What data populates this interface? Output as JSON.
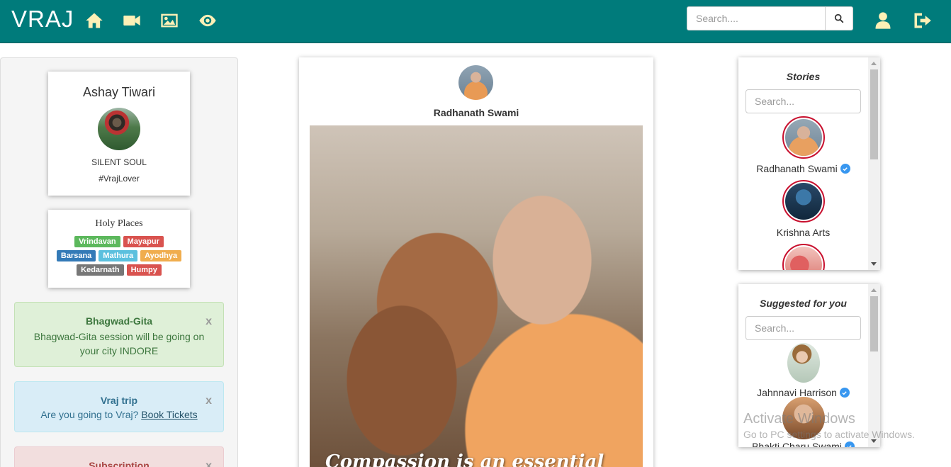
{
  "navbar": {
    "brand": "VRAJ",
    "search_placeholder": "Search....",
    "icons": [
      "home-icon",
      "video-camera-icon",
      "image-icon",
      "eye-icon",
      "user-icon",
      "logout-icon",
      "search-icon"
    ],
    "color": "#007b7b",
    "icon_color": "#fdf0b6"
  },
  "profile": {
    "name": "Ashay Tiwari",
    "status": "SILENT SOUL",
    "tag": "#VrajLover"
  },
  "holy_places": {
    "title": "Holy Places",
    "items": [
      {
        "label": "Vrindavan",
        "color": "#5cb85c"
      },
      {
        "label": "Mayapur",
        "color": "#d9534f"
      },
      {
        "label": "Barsana",
        "color": "#337ab7"
      },
      {
        "label": "Mathura",
        "color": "#5bc0de"
      },
      {
        "label": "Ayodhya",
        "color": "#f0ad4e"
      },
      {
        "label": "Kedarnath",
        "color": "#777777"
      },
      {
        "label": "Humpy",
        "color": "#d9534f"
      }
    ]
  },
  "alerts": {
    "gita": {
      "title": "Bhagwad-Gita",
      "body": "Bhagwad-Gita session will be going on your city INDORE",
      "close": "x"
    },
    "trip": {
      "title": "Vraj trip",
      "body": "Are you going to Vraj?",
      "link": "Book Tickets",
      "close": "x"
    },
    "subscription": {
      "title": "Subscription",
      "close": "x"
    }
  },
  "post": {
    "author": "Radhanath Swami",
    "caption": "Compassion is an essential"
  },
  "stories": {
    "title": "Stories",
    "search_placeholder": "Search...",
    "items": [
      {
        "name": "Radhanath Swami",
        "verified": true
      },
      {
        "name": "Krishna Arts",
        "verified": false
      }
    ]
  },
  "suggested": {
    "title": "Suggested for you",
    "search_placeholder": "Search...",
    "items": [
      {
        "name": "Jahnnavi Harrison",
        "verified": true
      },
      {
        "name": "Bhakti Charu Swami",
        "verified": true
      }
    ]
  },
  "watermark": {
    "line1": "Activate Windows",
    "line2": "Go to PC settings to activate Windows."
  }
}
